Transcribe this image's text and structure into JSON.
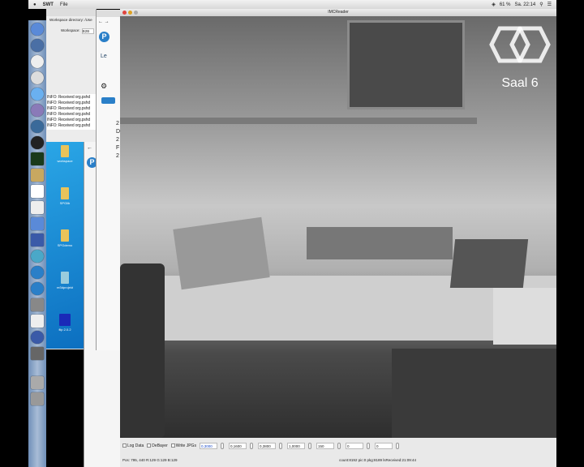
{
  "menubar": {
    "app": "SWT",
    "menu_file": "File",
    "clock": "Sa. 22:14",
    "battery": "61 %"
  },
  "workspace_dialog": {
    "dir_label": "Workspace directory: /Use",
    "workspace_label": "Workspace:",
    "workspace_value": "B2B",
    "log": [
      "INFO: Received org.pshd",
      "INFO: Received org.pshd",
      "INFO: Received org.pshd",
      "INFO: Received org.pshd",
      "INFO: Received org.pshd",
      "INFO: Received org.pshd"
    ]
  },
  "desktop": {
    "icons": [
      {
        "label": "workspace",
        "type": "folder"
      },
      {
        "label": "SPGlib",
        "type": "folder"
      },
      {
        "label": "SPGdemo",
        "type": "folder"
      },
      {
        "label": "re3dprojekt",
        "type": "file"
      },
      {
        "label": "flip 2.0.2",
        "type": "app"
      }
    ]
  },
  "browser": {
    "badge": "P",
    "link_partial": "Le",
    "list_chars": [
      "2",
      "D",
      "2",
      "F",
      "2"
    ]
  },
  "imc": {
    "title": "IMCReader",
    "video_logo": "Saal 6",
    "controls": {
      "log_data": "Log Data",
      "debayer": "DeBayer",
      "write_jpgs": "Write JPGs",
      "values": [
        "0,3000",
        "0,1600",
        "0,3800",
        "1,0000",
        "150",
        "0",
        "0"
      ]
    },
    "status_left": "Pos:  795, 440 R:129 G:129 B:129",
    "status_right": "count:8192 pic:0 pkg:8189 lsReceived:21:09:44"
  }
}
